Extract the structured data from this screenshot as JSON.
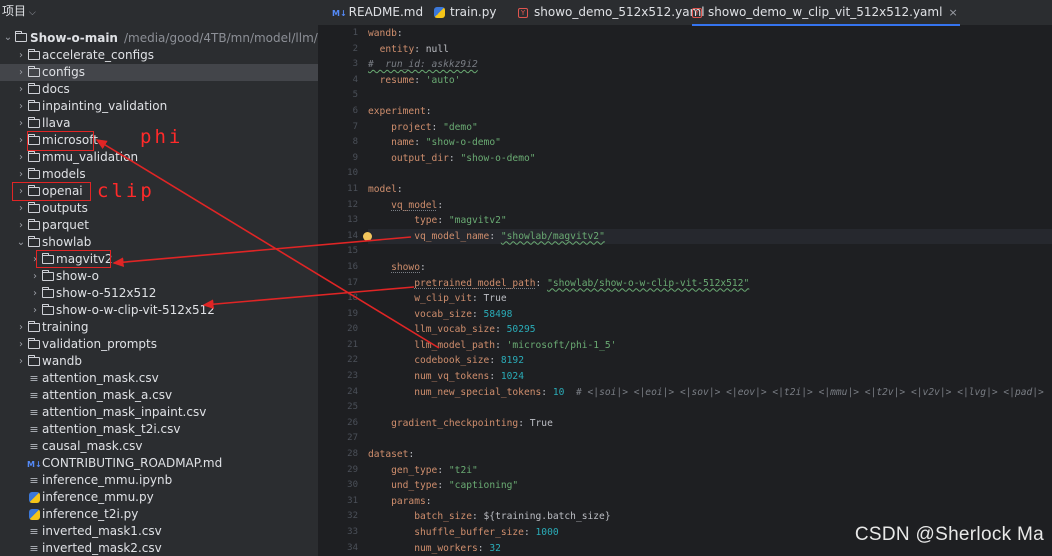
{
  "project": {
    "title": "项目",
    "root_name": "Show-o-main",
    "root_path": "/media/good/4TB/mn/model/llm/Show-o-m",
    "items": [
      {
        "label": "accelerate_configs",
        "kind": "folder",
        "depth": 1,
        "expanded": false
      },
      {
        "label": "configs",
        "kind": "folder",
        "depth": 1,
        "expanded": false,
        "selected": true
      },
      {
        "label": "docs",
        "kind": "folder",
        "depth": 1,
        "expanded": false
      },
      {
        "label": "inpainting_validation",
        "kind": "folder",
        "depth": 1,
        "expanded": false
      },
      {
        "label": "llava",
        "kind": "folder",
        "depth": 1,
        "expanded": false
      },
      {
        "label": "microsoft",
        "kind": "folder",
        "depth": 1,
        "expanded": false
      },
      {
        "label": "mmu_validation",
        "kind": "folder",
        "depth": 1,
        "expanded": false
      },
      {
        "label": "models",
        "kind": "folder",
        "depth": 1,
        "expanded": false
      },
      {
        "label": "openai",
        "kind": "folder",
        "depth": 1,
        "expanded": false
      },
      {
        "label": "outputs",
        "kind": "folder",
        "depth": 1,
        "expanded": false
      },
      {
        "label": "parquet",
        "kind": "folder",
        "depth": 1,
        "expanded": false
      },
      {
        "label": "showlab",
        "kind": "folder",
        "depth": 1,
        "expanded": true
      },
      {
        "label": "magvitv2",
        "kind": "folder",
        "depth": 2,
        "expanded": false
      },
      {
        "label": "show-o",
        "kind": "folder",
        "depth": 2,
        "expanded": false
      },
      {
        "label": "show-o-512x512",
        "kind": "folder",
        "depth": 2,
        "expanded": false
      },
      {
        "label": "show-o-w-clip-vit-512x512",
        "kind": "folder",
        "depth": 2,
        "expanded": false
      },
      {
        "label": "training",
        "kind": "folder",
        "depth": 1,
        "expanded": false
      },
      {
        "label": "validation_prompts",
        "kind": "folder",
        "depth": 1,
        "expanded": false
      },
      {
        "label": "wandb",
        "kind": "folder",
        "depth": 1,
        "expanded": false
      },
      {
        "label": "attention_mask.csv",
        "kind": "text",
        "depth": 1
      },
      {
        "label": "attention_mask_a.csv",
        "kind": "text",
        "depth": 1
      },
      {
        "label": "attention_mask_inpaint.csv",
        "kind": "text",
        "depth": 1
      },
      {
        "label": "attention_mask_t2i.csv",
        "kind": "text",
        "depth": 1
      },
      {
        "label": "causal_mask.csv",
        "kind": "text",
        "depth": 1
      },
      {
        "label": "CONTRIBUTING_ROADMAP.md",
        "kind": "md",
        "depth": 1
      },
      {
        "label": "inference_mmu.ipynb",
        "kind": "text",
        "depth": 1
      },
      {
        "label": "inference_mmu.py",
        "kind": "py",
        "depth": 1
      },
      {
        "label": "inference_t2i.py",
        "kind": "py",
        "depth": 1
      },
      {
        "label": "inverted_mask1.csv",
        "kind": "text",
        "depth": 1
      },
      {
        "label": "inverted_mask2.csv",
        "kind": "text",
        "depth": 1
      }
    ]
  },
  "tabs": [
    {
      "label": "README.md",
      "icon": "markdown-icon",
      "icon_text": "M↓"
    },
    {
      "label": "train.py",
      "icon": "python-icon"
    },
    {
      "label": "showo_demo_512x512.yaml",
      "icon": "yaml-icon"
    },
    {
      "label": "showo_demo_w_clip_vit_512x512.yaml",
      "icon": "yaml-icon",
      "active": true,
      "close": "×"
    }
  ],
  "editor": {
    "current_line": 14,
    "lines": [
      {
        "n": 1,
        "t": [
          [
            "k",
            "wandb"
          ],
          [
            "p",
            ":"
          ]
        ]
      },
      {
        "n": 2,
        "t": [
          [
            "p",
            "  "
          ],
          [
            "k",
            "entity"
          ],
          [
            "p",
            ": null"
          ]
        ]
      },
      {
        "n": 3,
        "t": [
          [
            "c",
            "#  run_id: askkz9i2"
          ]
        ]
      },
      {
        "n": 4,
        "t": [
          [
            "p",
            "  "
          ],
          [
            "k",
            "resume"
          ],
          [
            "p",
            ": "
          ],
          [
            "s",
            "'auto'"
          ]
        ]
      },
      {
        "n": 5,
        "t": []
      },
      {
        "n": 6,
        "t": [
          [
            "k",
            "experiment"
          ],
          [
            "p",
            ":"
          ]
        ]
      },
      {
        "n": 7,
        "t": [
          [
            "p",
            "    "
          ],
          [
            "k",
            "project"
          ],
          [
            "p",
            ": "
          ],
          [
            "s",
            "\"demo\""
          ]
        ]
      },
      {
        "n": 8,
        "t": [
          [
            "p",
            "    "
          ],
          [
            "k",
            "name"
          ],
          [
            "p",
            ": "
          ],
          [
            "s",
            "\"show-o-demo\""
          ]
        ]
      },
      {
        "n": 9,
        "t": [
          [
            "p",
            "    "
          ],
          [
            "k",
            "output_dir"
          ],
          [
            "p",
            ": "
          ],
          [
            "s",
            "\"show-o-demo\""
          ]
        ]
      },
      {
        "n": 10,
        "t": []
      },
      {
        "n": 11,
        "t": [
          [
            "k",
            "model"
          ],
          [
            "p",
            ":"
          ]
        ]
      },
      {
        "n": 12,
        "t": [
          [
            "p",
            "    "
          ],
          [
            "k",
            "vq_model"
          ],
          [
            "p",
            ":"
          ]
        ]
      },
      {
        "n": 13,
        "t": [
          [
            "p",
            "        "
          ],
          [
            "k",
            "type"
          ],
          [
            "p",
            ": "
          ],
          [
            "s",
            "\"magvitv2\""
          ]
        ]
      },
      {
        "n": 14,
        "t": [
          [
            "p",
            "        "
          ],
          [
            "k",
            "vq_model_name"
          ],
          [
            "p",
            ": "
          ],
          [
            "s",
            "\"showlab/magvitv2\""
          ]
        ]
      },
      {
        "n": 15,
        "t": []
      },
      {
        "n": 16,
        "t": [
          [
            "p",
            "    "
          ],
          [
            "k",
            "showo"
          ],
          [
            "p",
            ":"
          ]
        ]
      },
      {
        "n": 17,
        "t": [
          [
            "p",
            "        "
          ],
          [
            "k",
            "pretrained_model_path"
          ],
          [
            "p",
            ": "
          ],
          [
            "s",
            "\"showlab/show-o-w-clip-vit-512x512\""
          ]
        ]
      },
      {
        "n": 18,
        "t": [
          [
            "p",
            "        "
          ],
          [
            "k",
            "w_clip_vit"
          ],
          [
            "p",
            ": True"
          ]
        ]
      },
      {
        "n": 19,
        "t": [
          [
            "p",
            "        "
          ],
          [
            "k",
            "vocab_size"
          ],
          [
            "p",
            ": "
          ],
          [
            "n",
            "58498"
          ]
        ]
      },
      {
        "n": 20,
        "t": [
          [
            "p",
            "        "
          ],
          [
            "k",
            "llm_vocab_size"
          ],
          [
            "p",
            ": "
          ],
          [
            "n",
            "50295"
          ]
        ]
      },
      {
        "n": 21,
        "t": [
          [
            "p",
            "        "
          ],
          [
            "k",
            "llm_model_path"
          ],
          [
            "p",
            ": "
          ],
          [
            "s",
            "'microsoft/phi-1_5'"
          ]
        ]
      },
      {
        "n": 22,
        "t": [
          [
            "p",
            "        "
          ],
          [
            "k",
            "codebook_size"
          ],
          [
            "p",
            ": "
          ],
          [
            "n",
            "8192"
          ]
        ]
      },
      {
        "n": 23,
        "t": [
          [
            "p",
            "        "
          ],
          [
            "k",
            "num_vq_tokens"
          ],
          [
            "p",
            ": "
          ],
          [
            "n",
            "1024"
          ]
        ]
      },
      {
        "n": 24,
        "t": [
          [
            "p",
            "        "
          ],
          [
            "k",
            "num_new_special_tokens"
          ],
          [
            "p",
            ": "
          ],
          [
            "n",
            "10"
          ],
          [
            "p",
            "  "
          ],
          [
            "c",
            "# <|soi|> <|eoi|> <|sov|> <|eov|> <|t2i|> <|mmu|> <|t2v|> <|v2v|> <|lvg|> <|pad|>"
          ]
        ]
      },
      {
        "n": 25,
        "t": []
      },
      {
        "n": 26,
        "t": [
          [
            "p",
            "    "
          ],
          [
            "k",
            "gradient_checkpointing"
          ],
          [
            "p",
            ": True"
          ]
        ]
      },
      {
        "n": 27,
        "t": []
      },
      {
        "n": 28,
        "t": [
          [
            "k",
            "dataset"
          ],
          [
            "p",
            ":"
          ]
        ]
      },
      {
        "n": 29,
        "t": [
          [
            "p",
            "    "
          ],
          [
            "k",
            "gen_type"
          ],
          [
            "p",
            ": "
          ],
          [
            "s",
            "\"t2i\""
          ]
        ]
      },
      {
        "n": 30,
        "t": [
          [
            "p",
            "    "
          ],
          [
            "k",
            "und_type"
          ],
          [
            "p",
            ": "
          ],
          [
            "s",
            "\"captioning\""
          ]
        ]
      },
      {
        "n": 31,
        "t": [
          [
            "p",
            "    "
          ],
          [
            "k",
            "params"
          ],
          [
            "p",
            ":"
          ]
        ]
      },
      {
        "n": 32,
        "t": [
          [
            "p",
            "        "
          ],
          [
            "k",
            "batch_size"
          ],
          [
            "p",
            ": ${training.batch_size}"
          ]
        ]
      },
      {
        "n": 33,
        "t": [
          [
            "p",
            "        "
          ],
          [
            "k",
            "shuffle_buffer_size"
          ],
          [
            "p",
            ": "
          ],
          [
            "n",
            "1000"
          ]
        ]
      },
      {
        "n": 34,
        "t": [
          [
            "p",
            "        "
          ],
          [
            "k",
            "num_workers"
          ],
          [
            "p",
            ": "
          ],
          [
            "n",
            "32"
          ]
        ]
      }
    ]
  },
  "annotations": {
    "phi": "phi",
    "clip": "clip",
    "color": "#e02525"
  },
  "watermark": "CSDN @Sherlock  Ma"
}
